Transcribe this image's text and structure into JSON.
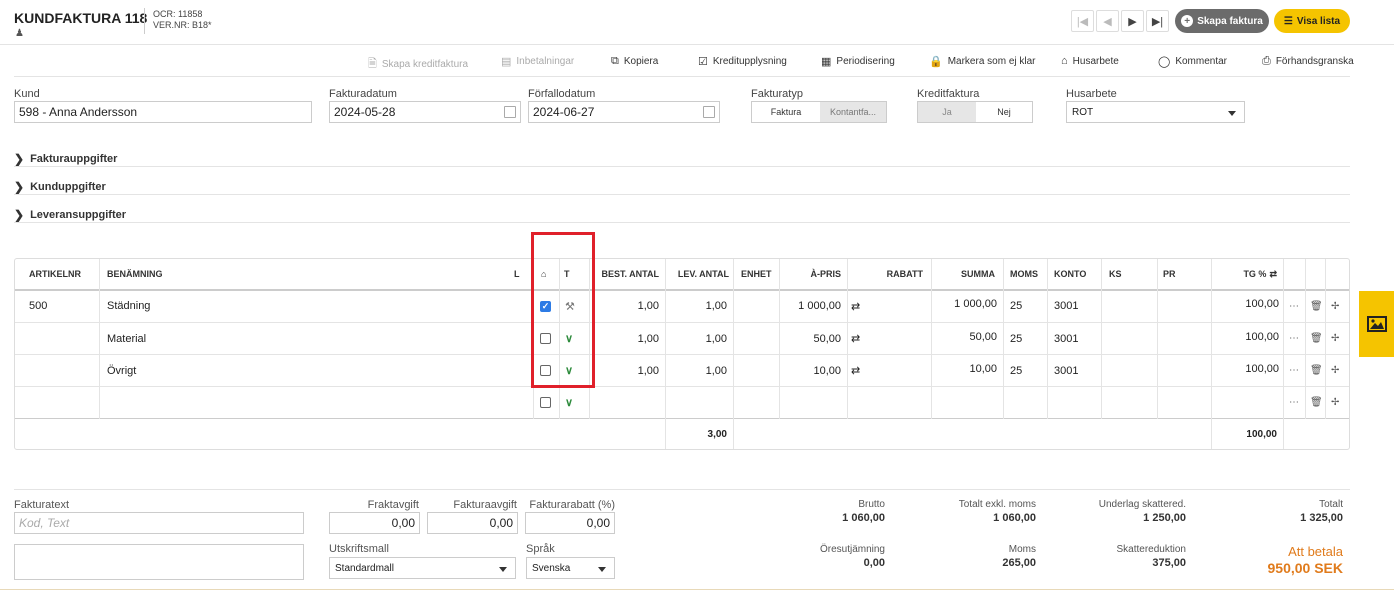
{
  "header": {
    "title": "KUNDFAKTURA 118",
    "ocr": "OCR: 11858",
    "vernr": "VER.NR: B18*",
    "nav": [
      "|◀",
      "◀",
      "▶",
      "▶|"
    ],
    "create_label": "Skapa faktura",
    "list_label": "Visa lista"
  },
  "toolbar": {
    "items": [
      {
        "label": "Skapa kreditfaktura",
        "icon": "document-icon",
        "enabled": false
      },
      {
        "label": "Inbetalningar",
        "icon": "money-icon",
        "enabled": false
      },
      {
        "label": "Kopiera",
        "icon": "copy-icon",
        "enabled": true
      },
      {
        "label": "Kreditupplysning",
        "icon": "check-square-icon",
        "enabled": true
      },
      {
        "label": "Periodisering",
        "icon": "calendar-icon",
        "enabled": true
      },
      {
        "label": "Markera som ej klar",
        "icon": "lock-icon",
        "enabled": true
      },
      {
        "label": "Husarbete",
        "icon": "home-icon",
        "enabled": true
      },
      {
        "label": "Kommentar",
        "icon": "comment-icon",
        "enabled": true
      },
      {
        "label": "Förhandsgranska",
        "icon": "print-icon",
        "enabled": true
      }
    ]
  },
  "form": {
    "kund_label": "Kund",
    "kund_value": "598 - Anna Andersson",
    "fakturadatum_label": "Fakturadatum",
    "fakturadatum_value": "2024-05-28",
    "forfallodatum_label": "Förfallodatum",
    "forfallodatum_value": "2024-06-27",
    "fakturatyp_label": "Fakturatyp",
    "fakturatyp_options": [
      "Faktura",
      "Kontantfa..."
    ],
    "kreditfaktura_label": "Kreditfaktura",
    "kreditfaktura_options": [
      "Ja",
      "Nej"
    ],
    "husarbete_label": "Husarbete",
    "husarbete_value": "ROT"
  },
  "sections": [
    "Fakturauppgifter",
    "Kunduppgifter",
    "Leveransuppgifter"
  ],
  "table": {
    "headers": {
      "artikelnr": "ARTIKELNR",
      "benamning": "BENÄMNING",
      "l": "L",
      "t": "T",
      "best_antal": "BEST. ANTAL",
      "lev_antal": "LEV. ANTAL",
      "enhet": "ENHET",
      "apris": "À-PRIS",
      "rabatt": "RABATT",
      "summa": "SUMMA",
      "moms": "MOMS",
      "konto": "KONTO",
      "ks": "KS",
      "pr": "PR",
      "tg": "TG %"
    },
    "rows": [
      {
        "artikelnr": "500",
        "benamning": "Städning",
        "checked": true,
        "type": "hammer",
        "best": "1,00",
        "lev": "1,00",
        "apris": "1 000,00",
        "summa": "1 000,00",
        "moms": "25",
        "konto": "3001",
        "tg": "100,00"
      },
      {
        "artikelnr": "",
        "benamning": "Material",
        "checked": false,
        "type": "chevron",
        "best": "1,00",
        "lev": "1,00",
        "apris": "50,00",
        "summa": "50,00",
        "moms": "25",
        "konto": "3001",
        "tg": "100,00"
      },
      {
        "artikelnr": "",
        "benamning": "Övrigt",
        "checked": false,
        "type": "chevron",
        "best": "1,00",
        "lev": "1,00",
        "apris": "10,00",
        "summa": "10,00",
        "moms": "25",
        "konto": "3001",
        "tg": "100,00"
      }
    ],
    "total_lev": "3,00",
    "total_tg": "100,00"
  },
  "footer": {
    "fakturatext_label": "Fakturatext",
    "fakturatext_placeholder": "Kod, Text",
    "fraktavgift_label": "Fraktavgift",
    "fraktavgift_value": "0,00",
    "fakturaavgift_label": "Fakturaavgift",
    "fakturaavgift_value": "0,00",
    "fakturarabatt_label": "Fakturarabatt (%)",
    "fakturarabatt_value": "0,00",
    "utskriftsmall_label": "Utskriftsmall",
    "utskriftsmall_value": "Standardmall",
    "sprak_label": "Språk",
    "sprak_value": "Svenska",
    "brutto_label": "Brutto",
    "brutto_value": "1 060,00",
    "exkl_label": "Totalt exkl. moms",
    "exkl_value": "1 060,00",
    "underlag_label": "Underlag skattered.",
    "underlag_value": "1 250,00",
    "totalt_label": "Totalt",
    "totalt_value": "1 325,00",
    "ores_label": "Öresutjämning",
    "ores_value": "0,00",
    "moms_label": "Moms",
    "moms_value": "265,00",
    "skatte_label": "Skattereduktion",
    "skatte_value": "375,00",
    "att_betala_label": "Att betala",
    "att_betala_value": "950,00 SEK"
  }
}
